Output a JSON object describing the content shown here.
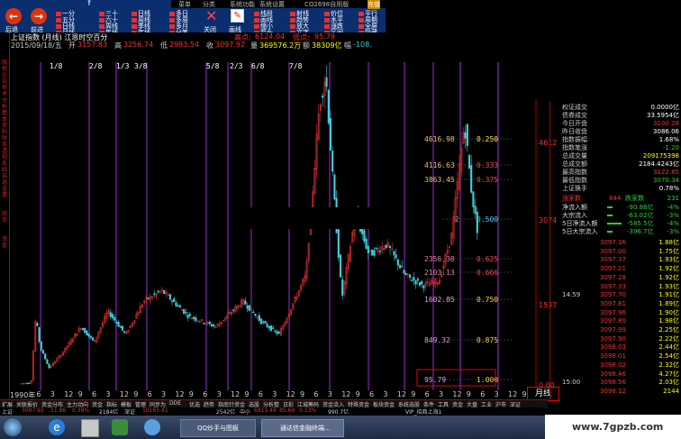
{
  "menu": [
    "菜单",
    "分类",
    "系统功能",
    "系统设置",
    "CQ2698自用版",
    "充值"
  ],
  "toolbar": {
    "back_label": "后退",
    "forward_label": "前进",
    "items_col1": [
      "一分",
      "五分",
      "日线",
      "月线"
    ],
    "items_col2": [
      "三十",
      "六十",
      "周线",
      "年线"
    ],
    "items_col3": [
      "日线",
      "周线",
      "季线",
      "年线"
    ],
    "items_col4": [
      "多日",
      "多周",
      "多月",
      "分笔"
    ],
    "close_label": "关闭",
    "draw_label": "画线",
    "items_col5": [
      "线段",
      "画线",
      "缩小",
      "箭头"
    ],
    "items_col6": [
      "射线",
      "趋势",
      "放大",
      "文字"
    ],
    "items_col7": [
      "价位",
      "水平",
      "涨跌",
      "区间"
    ],
    "items_col8": [
      "平行",
      "周期",
      "全屏",
      "隐藏"
    ]
  },
  "info": {
    "line1": "上证指数 (月线) 江恩时空百分",
    "high_lbl": "高点:",
    "high_val": "6124.04",
    "low_lbl": "低点:",
    "low_val": "95.79",
    "line2_date": "2015/09/18/五",
    "open_lbl": "开",
    "open_val": "3157.83",
    "hi_lbl": "高",
    "hi_val": "3256.74",
    "lo_lbl": "低",
    "lo_val": "2983.54",
    "close_lbl": "收",
    "close_val": "3097.92",
    "chg_lbl": "量",
    "chg_val": "369576.2万",
    "amt_lbl": "额",
    "amt_val": "38309亿",
    "amp_lbl": "幅",
    "amp_val": "-108."
  },
  "left_tabs": [
    "版权公告",
    "技术分析",
    "基本资料",
    "财务透视",
    "系统自选",
    "设置",
    "综合",
    "资金"
  ],
  "cycle_labels": [
    "1/8",
    "2/8",
    "1/3",
    "3/8",
    "5/8",
    "2/3",
    "6/8",
    "7/8"
  ],
  "levels": [
    {
      "price": "4616.98",
      "ratio": "0.250"
    },
    {
      "price": "4116.63",
      "ratio": "0.333"
    },
    {
      "price": "3863.45",
      "ratio": "0.375"
    },
    {
      "price": "",
      "ratio": "0.500"
    },
    {
      "price": "2356.38",
      "ratio": "0.625"
    },
    {
      "price": "2103.13",
      "ratio": "0.666"
    },
    {
      "price": "1602.85",
      "ratio": "0.750"
    },
    {
      "price": "849.32",
      "ratio": "0.875"
    },
    {
      "price": "95.79",
      "ratio": "1.000"
    }
  ],
  "level_ratio_two": "2",
  "right_axis": [
    "4612",
    "3074",
    "1537",
    "0.00"
  ],
  "rpanel": {
    "rows": [
      {
        "label": "权证成交",
        "value": "0.0000亿",
        "color": "#fff"
      },
      {
        "label": "债券成交",
        "value": "33.5954亿",
        "color": "#fff"
      },
      {
        "label": "今日开盘",
        "value": "3100.28",
        "color": "#e33"
      },
      {
        "label": "昨日收盘",
        "value": "3086.06",
        "color": "#fff"
      },
      {
        "label": "指数振幅",
        "value": "1.68%",
        "color": "#fff"
      },
      {
        "label": "指数笔涨",
        "value": "-1.20",
        "color": "#3c3"
      },
      {
        "label": "总成交量",
        "value": "209175398",
        "color": "#ff0"
      },
      {
        "label": "总成交额",
        "value": "2184.4243亿",
        "color": "#fff"
      },
      {
        "label": "最高指数",
        "value": "3122.85",
        "color": "#e33"
      },
      {
        "label": "最低指数",
        "value": "3070.34",
        "color": "#3c3"
      },
      {
        "label": "上证换手",
        "value": "0.78%",
        "color": "#fff"
      }
    ],
    "rise_lbl": "涨家数",
    "rise_val": "844",
    "fall_lbl": "跌家数",
    "fall_val": "231",
    "flows": [
      {
        "label": "净流入额",
        "value": "-90.86亿",
        "pct": "-4%"
      },
      {
        "label": "大宗流入",
        "value": "-63.02亿",
        "pct": "-3%"
      },
      {
        "label": "5日净流入额",
        "value": "-585.5亿",
        "pct": "-4%"
      },
      {
        "label": "5日大宗流入",
        "value": "-396.7亿",
        "pct": "-3%"
      }
    ],
    "ticks": [
      {
        "time": "",
        "price": "3097.16",
        "vol": "1.88亿"
      },
      {
        "time": "",
        "price": "3097.00",
        "vol": "1.75亿"
      },
      {
        "time": "",
        "price": "3097.37",
        "vol": "1.93亿"
      },
      {
        "time": "",
        "price": "3097.21",
        "vol": "1.92亿"
      },
      {
        "time": "",
        "price": "3097.28",
        "vol": "1.92亿"
      },
      {
        "time": "",
        "price": "3097.33",
        "vol": "1.93亿"
      },
      {
        "time": "14:59",
        "price": "3097.70",
        "vol": "1.91亿"
      },
      {
        "time": "",
        "price": "3097.81",
        "vol": "1.89亿"
      },
      {
        "time": "",
        "price": "3097.96",
        "vol": "1.90亿"
      },
      {
        "time": "",
        "price": "3097.80",
        "vol": "1.98亿"
      },
      {
        "time": "",
        "price": "3097.99",
        "vol": "2.25亿"
      },
      {
        "time": "",
        "price": "3097.90",
        "vol": "2.22亿"
      },
      {
        "time": "",
        "price": "3098.03",
        "vol": "2.44亿"
      },
      {
        "time": "",
        "price": "3098.01",
        "vol": "2.54亿"
      },
      {
        "time": "",
        "price": "3098.02",
        "vol": "2.32亿"
      },
      {
        "time": "",
        "price": "3098.46",
        "vol": "4.27亿"
      },
      {
        "time": "15:00",
        "price": "3098.56",
        "vol": "2.03亿"
      },
      {
        "time": "",
        "price": "3098.12",
        "vol": "2144"
      }
    ]
  },
  "xaxis": [
    "1990年",
    "6",
    "3",
    "12",
    "9",
    "6",
    "3",
    "12",
    "9",
    "6",
    "3",
    "12",
    "9",
    "6",
    "3",
    "12",
    "9",
    "6",
    "3",
    "12",
    "9",
    "6",
    "3",
    "12",
    "9",
    "6",
    "3",
    "12",
    "9",
    "6",
    "3",
    "12",
    "9",
    "6",
    "3",
    "12",
    "9"
  ],
  "period_label": "月线",
  "bottom_tabs": [
    "扩展",
    "关联报价",
    "资金分布",
    "主力动向",
    "资金",
    "指标",
    "模板",
    "管理",
    "同步为",
    "DDE",
    "优选",
    "趋势",
    "指南针资金",
    "选股",
    "分析整",
    "日彩",
    "江城筹码",
    "资金流入",
    "特殊资金",
    "板块资金",
    "系统选股",
    "条件",
    "工具",
    "资金",
    "大盘",
    "工业",
    "沪市",
    "深证",
    "中小板",
    "创业板"
  ],
  "status": {
    "sh_lbl": "上证",
    "sh_val": "3097.92",
    "sh_chg": "11.86",
    "sh_pct": "0.38%",
    "sh_amt": "2184亿",
    "sz_lbl": "深证",
    "sz_val": "10165.41",
    "sz_amt": "2542亿",
    "zx_lbl": "中小",
    "zx_val": "6911.49",
    "zx_chg": "85.69",
    "zx_pct": "0.13%",
    "zx_amt": "990.7亿",
    "vip": "VIP_招商上海1"
  },
  "taskbar": {
    "items": [
      "QQ炒手与图板",
      "通达信金融终端..."
    ],
    "watermark": "www.7gpzb.com"
  },
  "chart_data": {
    "type": "candlestick",
    "title": "上证指数 (月线) 江恩时空百分",
    "x_range": [
      "1990-12",
      "2015-09"
    ],
    "y_range": [
      0,
      6124.04
    ],
    "high": 6124.04,
    "low": 95.79,
    "last": {
      "open": 3157.83,
      "high": 3256.74,
      "low": 2983.54,
      "close": 3097.92
    }
  }
}
